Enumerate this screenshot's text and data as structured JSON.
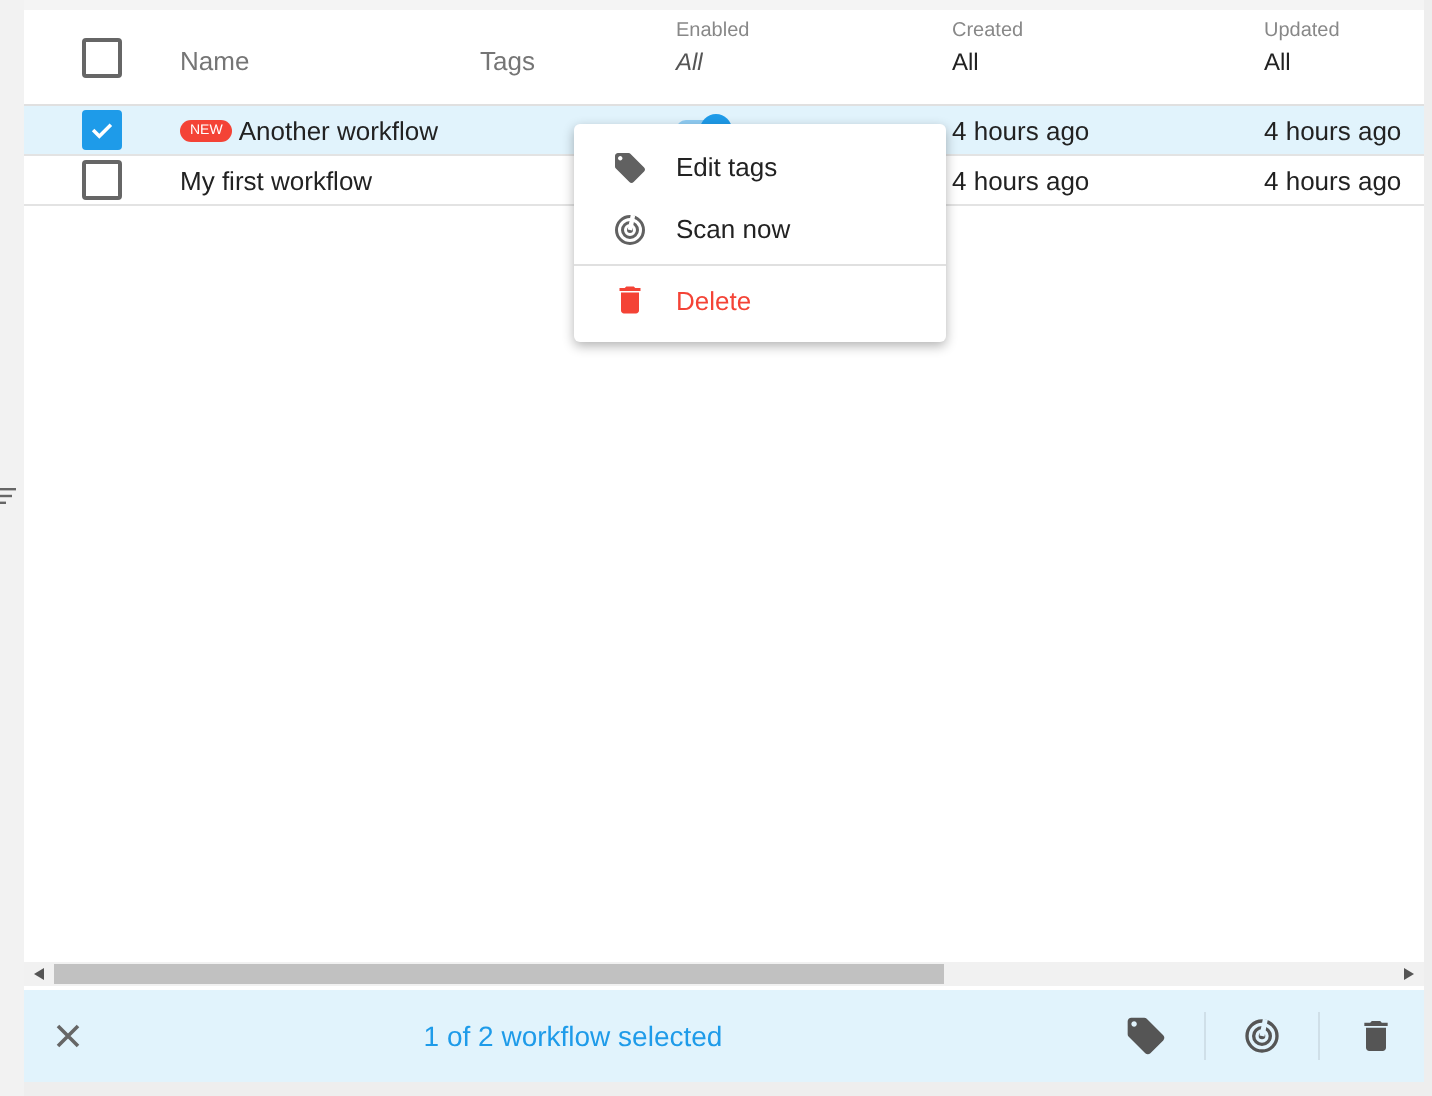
{
  "columns": [
    {
      "label": "Name"
    },
    {
      "label": "Tags"
    },
    {
      "label": "Enabled",
      "filter": "All",
      "italic": true
    },
    {
      "label": "Created",
      "filter": "All",
      "italic": false
    },
    {
      "label": "Updated",
      "filter": "All",
      "italic": false
    }
  ],
  "header_checked": false,
  "rows": [
    {
      "selected": true,
      "badge": "NEW",
      "name": "Another workflow",
      "enabled": true,
      "created": "4 hours ago",
      "updated": "4 hours ago"
    },
    {
      "selected": false,
      "name": "My first workflow",
      "created": "4 hours ago",
      "updated": "4 hours ago"
    }
  ],
  "context_menu": [
    {
      "kind": "tag",
      "label": "Edit tags"
    },
    {
      "kind": "scan",
      "label": "Scan now"
    },
    {
      "kind": "delete",
      "label": "Delete"
    }
  ],
  "selection_bar": {
    "text": "1 of 2 workflow selected"
  }
}
